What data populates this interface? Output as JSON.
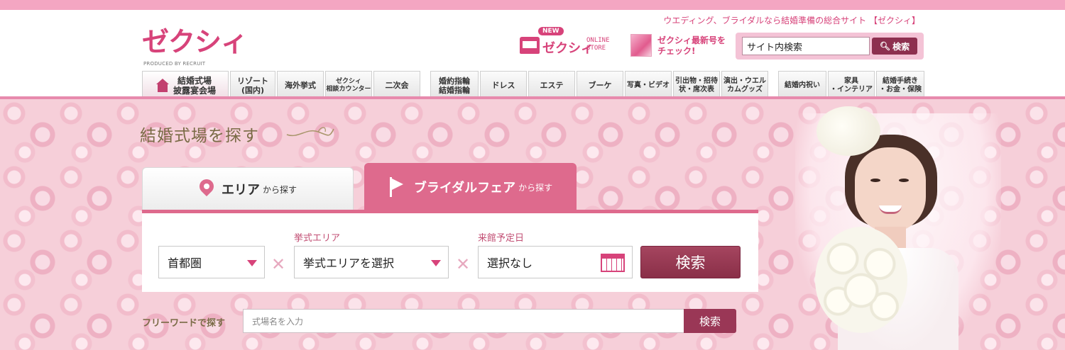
{
  "header": {
    "tagline": "ウエディング、ブライダルなら結婚準備の総合サイト 【ゼクシィ】",
    "logo": {
      "name": "ゼクシィ",
      "sub": "PRODUCED BY RECRUIT"
    },
    "store": {
      "badge": "NEW",
      "name": "ゼクシィ",
      "sub": "ONLINE STORE"
    },
    "magazine": {
      "line1": "ゼクシィ最新号を",
      "line2": "チェック!"
    },
    "search": {
      "value": "サイト内検索",
      "button": "検索"
    }
  },
  "nav": {
    "items": [
      {
        "label": "結婚式場\n披露宴会場"
      },
      {
        "label": "リゾート\n(国内)"
      },
      {
        "label": "海外挙式"
      },
      {
        "label": "ゼクシィ\n相談カウンター"
      },
      {
        "label": "二次会"
      },
      {
        "label": "婚約指輪\n結婚指輪"
      },
      {
        "label": "ドレス"
      },
      {
        "label": "エステ"
      },
      {
        "label": "ブーケ"
      },
      {
        "label": "写真・ビデオ"
      },
      {
        "label": "引出物・招待\n状・席次表"
      },
      {
        "label": "演出・ウエル\nカムグッズ"
      },
      {
        "label": "結婚内祝い"
      },
      {
        "label": "家具\n・インテリア"
      },
      {
        "label": "結婚手続き\n・お金・保険"
      }
    ]
  },
  "main": {
    "heading": "結婚式場を探す",
    "tabs": [
      {
        "label": "エリア",
        "suffix": "から探す"
      },
      {
        "label": "ブライダルフェア",
        "suffix": "から探す"
      }
    ],
    "fields": {
      "region": {
        "value": "首都圏"
      },
      "ceremony_area": {
        "label": "挙式エリア",
        "value": "挙式エリアを選択"
      },
      "visit_date": {
        "label": "来館予定日",
        "value": "選択なし"
      }
    },
    "search_button": "検索",
    "freeword": {
      "label": "フリーワードで探す",
      "placeholder": "式場名を入力",
      "button": "検索"
    }
  },
  "colors": {
    "brand": "#d7437a",
    "accent": "#de6a8d",
    "button": "#8d2f4f"
  }
}
